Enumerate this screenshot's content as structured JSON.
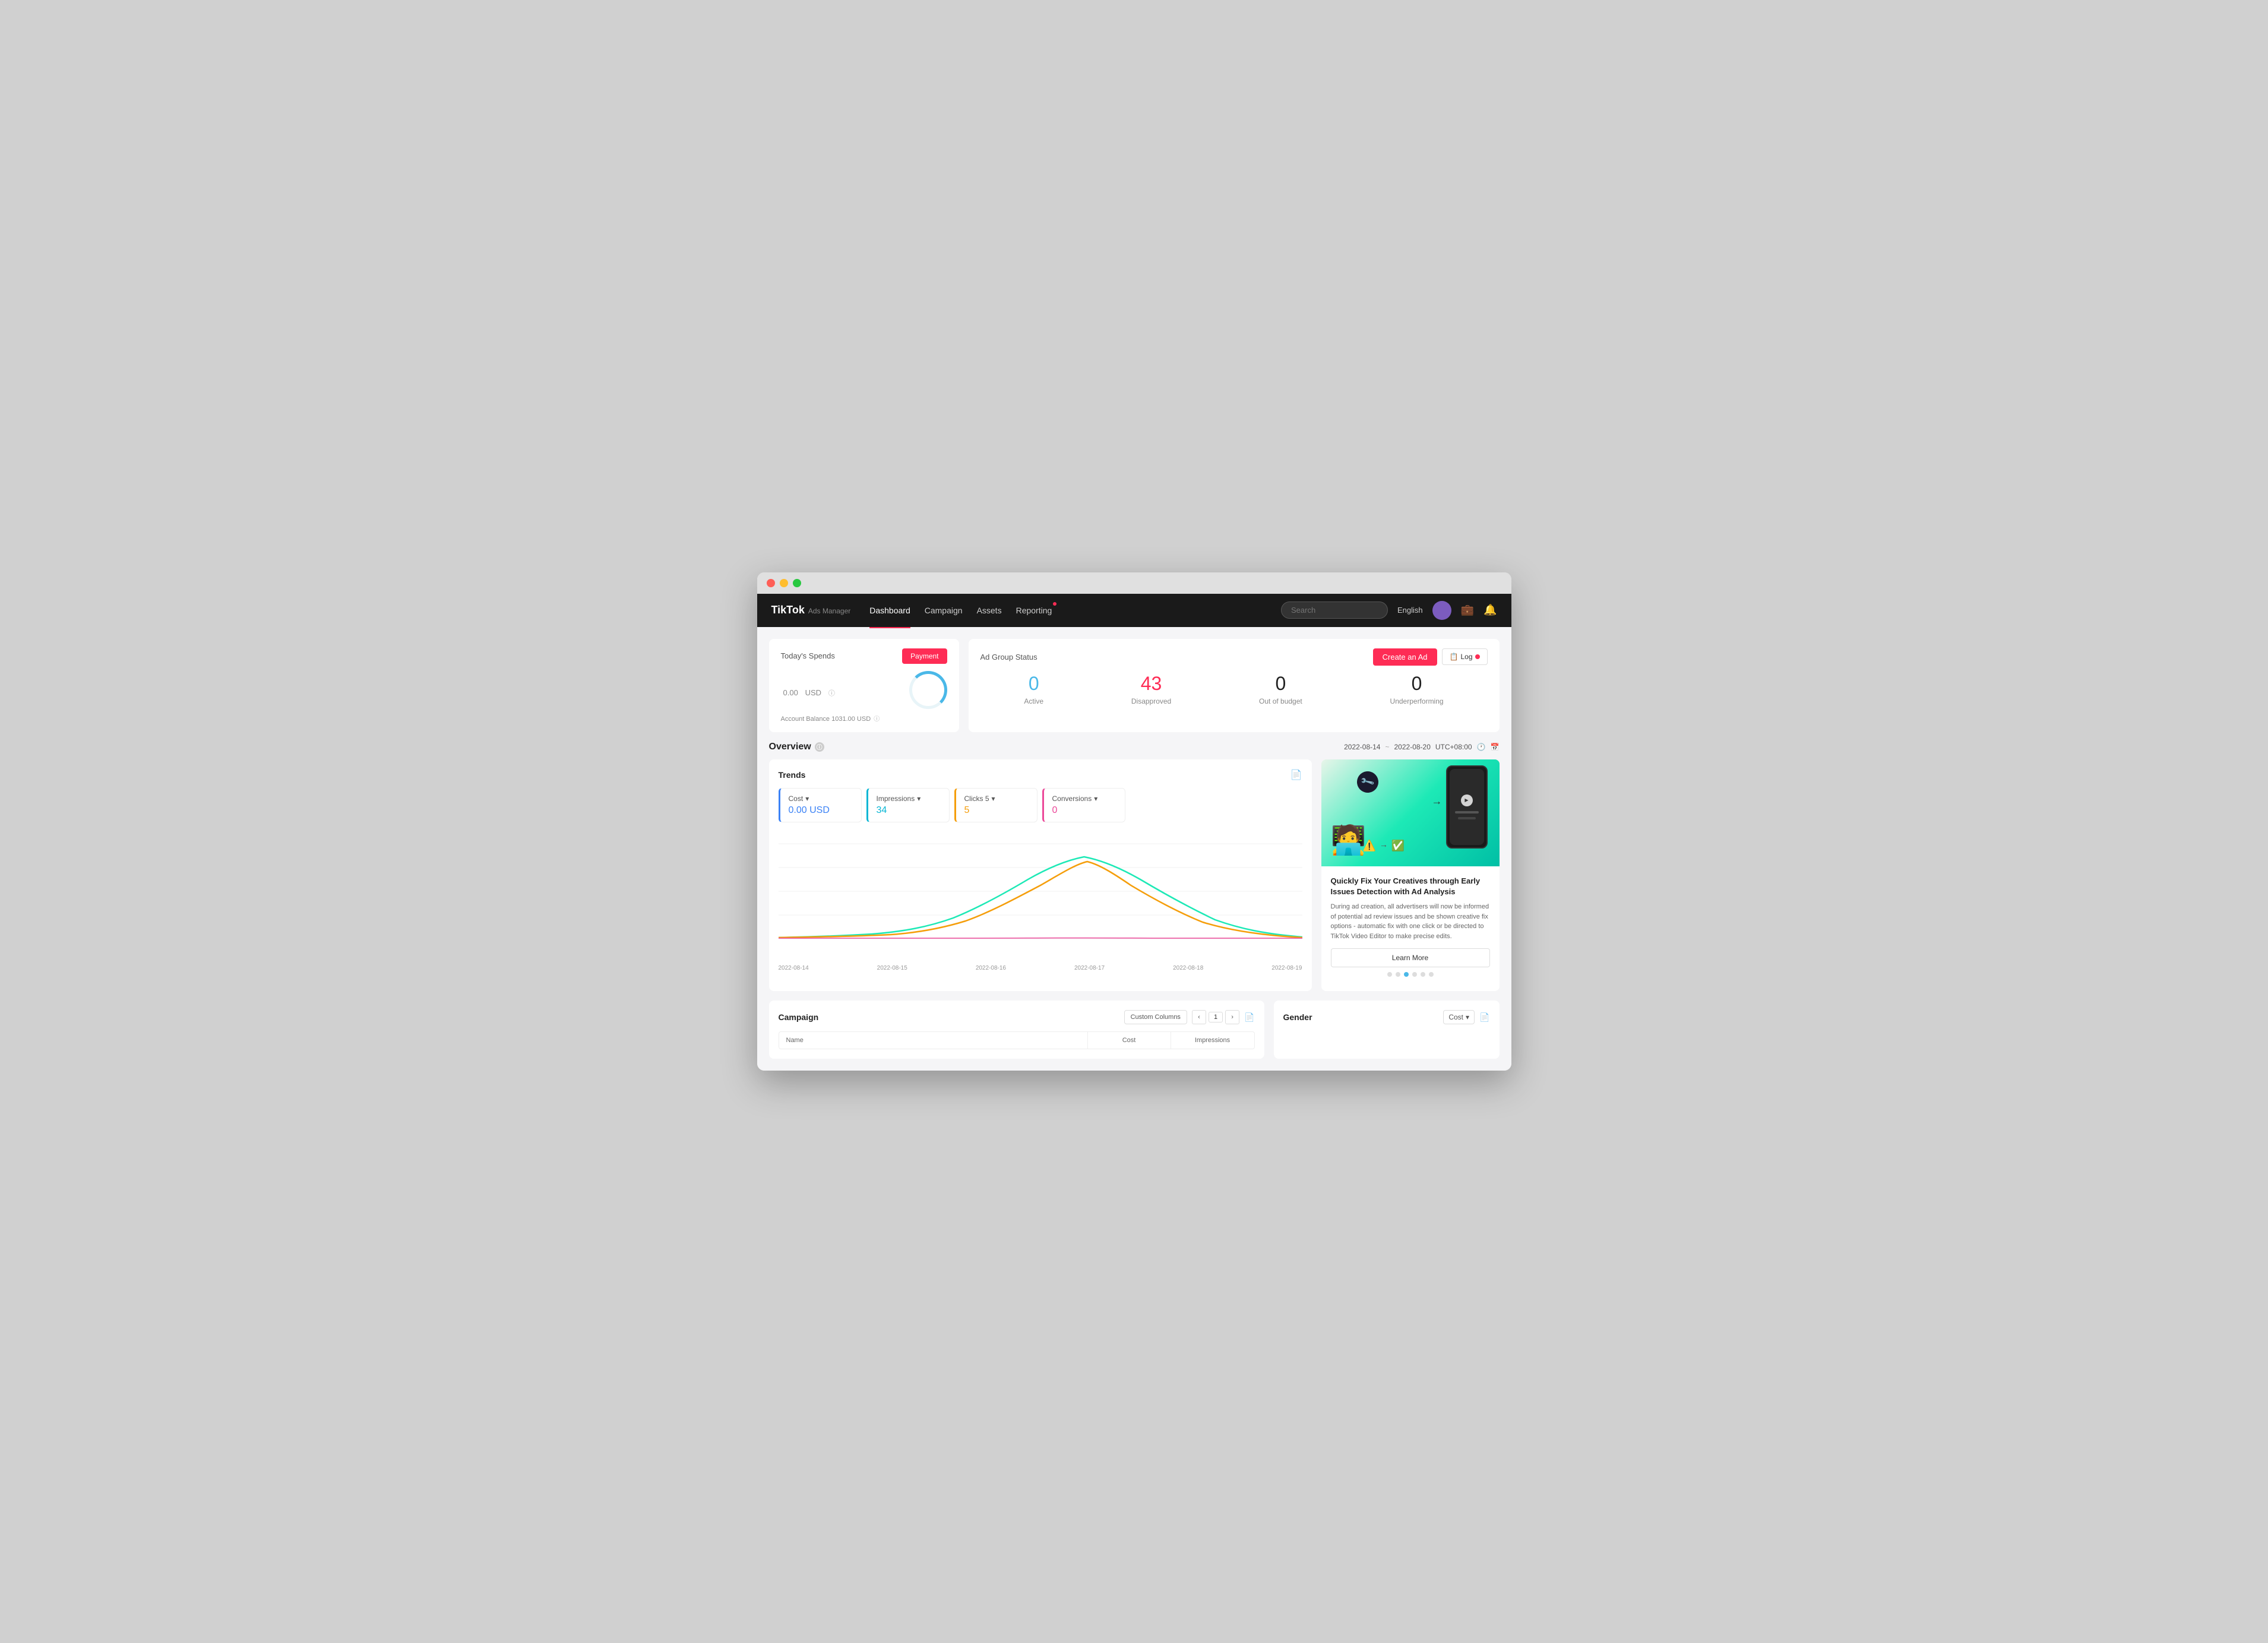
{
  "window": {
    "title": "TikTok Ads Manager"
  },
  "nav": {
    "logo": "TikTok",
    "logo_sub": "Ads Manager",
    "links": [
      {
        "label": "Dashboard",
        "active": true
      },
      {
        "label": "Campaign",
        "active": false
      },
      {
        "label": "Assets",
        "active": false
      },
      {
        "label": "Reporting",
        "active": false,
        "has_dot": true
      }
    ],
    "search_placeholder": "Search",
    "lang": "English"
  },
  "today_spends": {
    "title": "Today's Spends",
    "payment_btn": "Payment",
    "amount": "0.00",
    "currency": "USD",
    "balance_label": "Account Balance 1031.00 USD"
  },
  "ad_group_status": {
    "title": "Ad Group Status",
    "create_ad_btn": "Create an Ad",
    "log_btn": "Log",
    "stats": [
      {
        "label": "Active",
        "value": "0",
        "color": "active-color"
      },
      {
        "label": "Disapproved",
        "value": "43",
        "color": "disapproved-color"
      },
      {
        "label": "Out of budget",
        "value": "0",
        "color": "neutral"
      },
      {
        "label": "Underperforming",
        "value": "0",
        "color": "neutral"
      }
    ]
  },
  "overview": {
    "title": "Overview",
    "date_start": "2022-08-14",
    "date_end": "2022-08-20",
    "timezone": "UTC+08:00"
  },
  "trends": {
    "title": "Trends",
    "metrics": [
      {
        "label": "Cost",
        "value": "0.00 USD",
        "color": "blue",
        "type": "cost"
      },
      {
        "label": "Impressions",
        "value": "34",
        "color": "cyan",
        "type": "impressions"
      },
      {
        "label": "Clicks 5",
        "value": "5",
        "color": "orange",
        "type": "clicks"
      },
      {
        "label": "Conversions",
        "value": "0",
        "color": "pink",
        "type": "conversions"
      }
    ],
    "x_labels": [
      "2022-08-14",
      "2022-08-15",
      "2022-08-16",
      "2022-08-17",
      "2022-08-18",
      "2022-08-19"
    ]
  },
  "promo_card": {
    "title": "Quickly Fix Your Creatives through Early Issues Detection with Ad Analysis",
    "description": "During ad creation, all advertisers will now be informed of potential ad review issues and be shown creative fix options - automatic fix with one click or be directed to TikTok Video Editor to make precise edits.",
    "learn_more_btn": "Learn More",
    "dots_count": 6,
    "active_dot": 2
  },
  "campaign": {
    "title": "Campaign",
    "custom_cols_btn": "Custom Columns",
    "page_num": "1",
    "columns": [
      {
        "label": "Name"
      },
      {
        "label": "Cost"
      },
      {
        "label": "Impressions"
      }
    ]
  },
  "gender": {
    "title": "Gender",
    "cost_label": "Cost",
    "dropdown_arrow": "▾"
  }
}
